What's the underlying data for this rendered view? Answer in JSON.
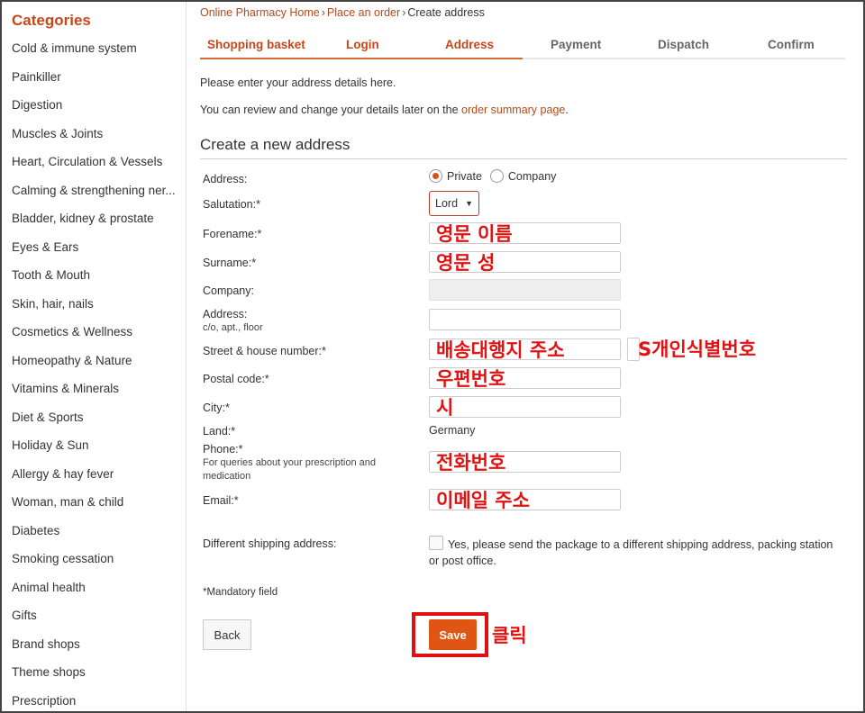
{
  "sidebar": {
    "title": "Categories",
    "items": [
      "Cold & immune system",
      "Painkiller",
      "Digestion",
      "Muscles & Joints",
      "Heart, Circulation & Vessels",
      "Calming & strengthening ner...",
      "Bladder, kidney & prostate",
      "Eyes & Ears",
      "Tooth & Mouth",
      "Skin, hair, nails",
      "Cosmetics & Wellness",
      "Homeopathy & Nature",
      "Vitamins & Minerals",
      "Diet & Sports",
      "Holiday & Sun",
      "Allergy & hay fever",
      "Woman, man & child",
      "Diabetes",
      "Smoking cessation",
      "Animal health",
      "Gifts",
      "Brand shops",
      "Theme shops",
      "Prescription"
    ]
  },
  "breadcrumb": {
    "home": "Online Pharmacy Home",
    "order": "Place an order",
    "current": "Create address",
    "sep": "›"
  },
  "steps": {
    "shopping_basket": "Shopping basket",
    "login": "Login",
    "address": "Address",
    "payment": "Payment",
    "dispatch": "Dispatch",
    "confirm": "Confirm"
  },
  "intro": {
    "line1": "Please enter your address details here.",
    "line2_prefix": "You can review and change your details later on the ",
    "line2_link": "order summary page",
    "line2_suffix": "."
  },
  "form": {
    "title": "Create a new address",
    "address_label": "Address:",
    "private_label": "Private",
    "company_label": "Company",
    "salutation_label": "Salutation:*",
    "salutation_value": "Lord",
    "forename_label": "Forename:*",
    "surname_label": "Surname:*",
    "company_field_label": "Company:",
    "address2_label": "Address:",
    "address2_sub": "c/o, apt., floor",
    "street_label": "Street & house number:*",
    "postal_label": "Postal code:*",
    "city_label": "City:*",
    "land_label": "Land:*",
    "land_value": "Germany",
    "phone_label": "Phone:*",
    "phone_sub": "For queries about your prescription and medication",
    "email_label": "Email:*",
    "diff_shipping_label": "Different shipping address:",
    "diff_shipping_text": "Yes, please send the package to a different shipping address, packing station or post office.",
    "mandatory_note": "*Mandatory field",
    "back_label": "Back",
    "save_label": "Save"
  },
  "annotations": {
    "forename": "영문 이름",
    "surname": "영문 성",
    "street": "배송대행지 주소",
    "personal_id": "S개인식별번호",
    "postal": "우편번호",
    "city": "시",
    "phone": "전화번호",
    "email": "이메일 주소",
    "click": "클릭"
  },
  "colors": {
    "accent": "#c8471a",
    "save_button": "#e05514",
    "annotation": "#e31212"
  }
}
